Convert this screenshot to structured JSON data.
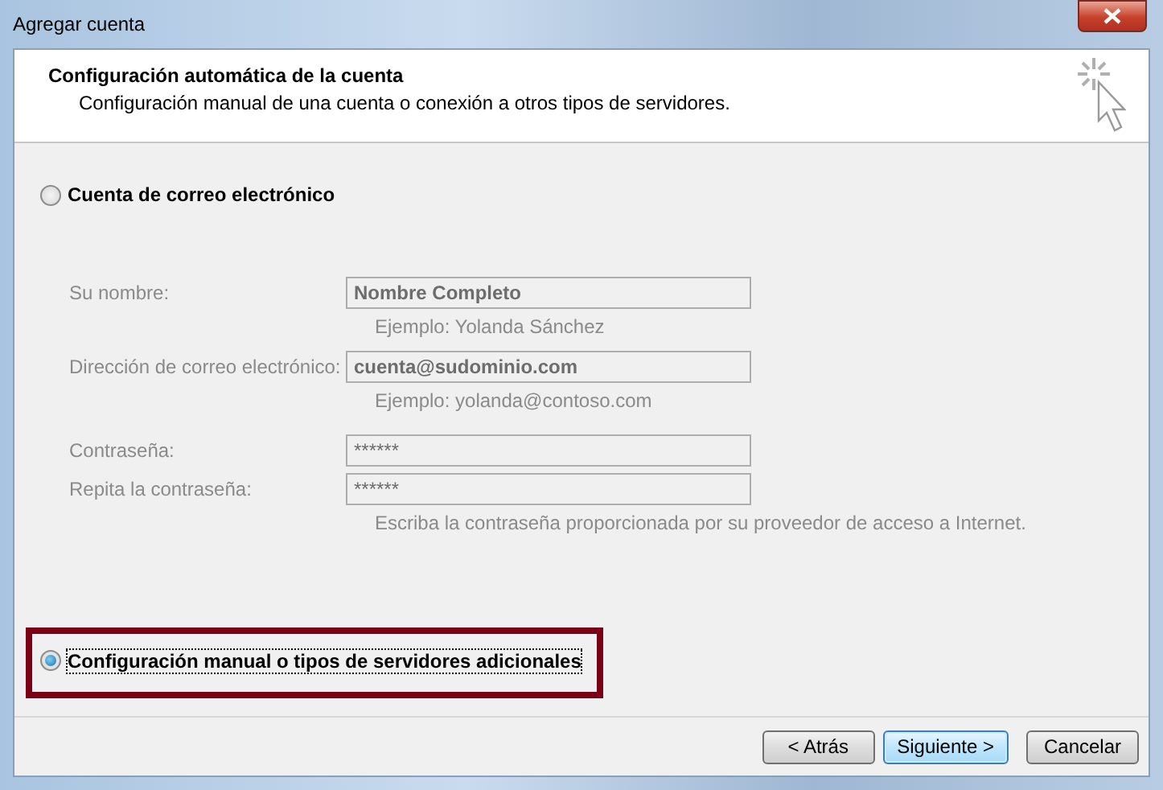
{
  "window": {
    "title": "Agregar cuenta"
  },
  "header": {
    "title": "Configuración automática de la cuenta",
    "subtitle": "Configuración manual de una cuenta o conexión a otros tipos de servidores."
  },
  "options": [
    {
      "label": "Cuenta de correo electrónico",
      "selected": false
    },
    {
      "label": "Configuración manual o tipos de servidores adicionales",
      "selected": true
    }
  ],
  "fields": [
    {
      "label": "Su nombre:",
      "kind": "text",
      "value": "Nombre Completo",
      "hint": "Ejemplo: Yolanda Sánchez",
      "disabled": true
    },
    {
      "label": "Dirección de correo electrónico:",
      "kind": "text",
      "value": "cuenta@sudominio.com",
      "hint": "Ejemplo: yolanda@contoso.com",
      "disabled": true
    },
    {
      "label": "Contraseña:",
      "kind": "password",
      "value": "******",
      "disabled": true
    },
    {
      "label": "Repita la contraseña:",
      "kind": "password",
      "value": "******",
      "hint": "Escriba la contraseña proporcionada por su proveedor de acceso a Internet.",
      "disabled": true
    }
  ],
  "buttons": [
    {
      "label": "< Atrás",
      "default": false
    },
    {
      "label": "Siguiente >",
      "default": true
    },
    {
      "label": "Cancelar",
      "default": false
    }
  ]
}
